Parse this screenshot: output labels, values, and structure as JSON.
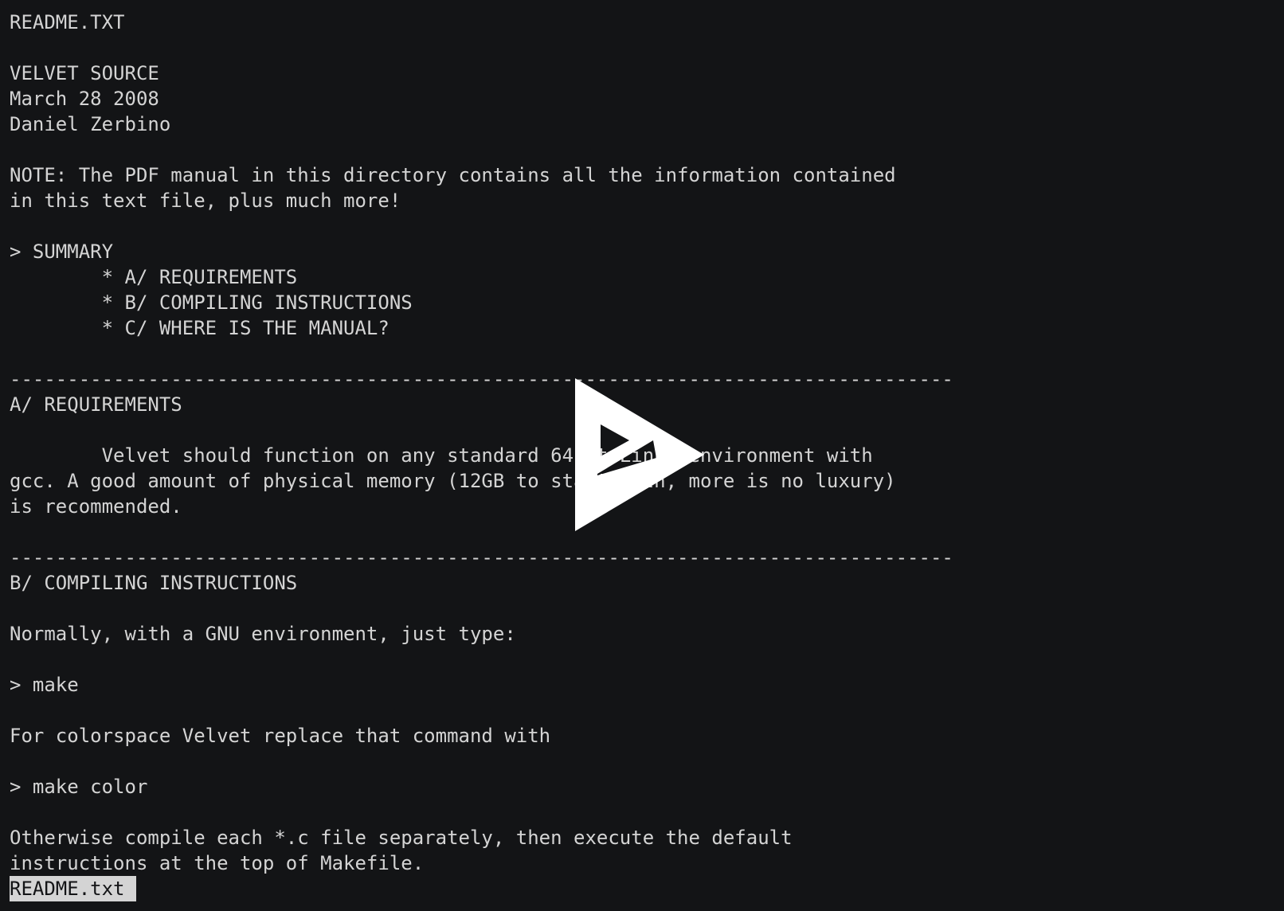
{
  "document": {
    "lines": [
      "README.TXT",
      "",
      "VELVET SOURCE",
      "March 28 2008",
      "Daniel Zerbino",
      "",
      "NOTE: The PDF manual in this directory contains all the information contained",
      "in this text file, plus much more!",
      "",
      "> SUMMARY",
      "        * A/ REQUIREMENTS",
      "        * B/ COMPILING INSTRUCTIONS",
      "        * C/ WHERE IS THE MANUAL?",
      "",
      "----------------------------------------------------------------------------------",
      "A/ REQUIREMENTS",
      "",
      "        Velvet should function on any standard 64bit Linux environment with",
      "gcc. A good amount of physical memory (12GB to start with, more is no luxury)",
      "is recommended.",
      "",
      "----------------------------------------------------------------------------------",
      "B/ COMPILING INSTRUCTIONS",
      "",
      "Normally, with a GNU environment, just type:",
      "",
      "> make",
      "",
      "For colorspace Velvet replace that command with",
      "",
      "> make color",
      "",
      "Otherwise compile each *.c file separately, then execute the default",
      "instructions at the top of Makefile."
    ]
  },
  "status_bar": {
    "filename": "README.txt"
  },
  "overlay": {
    "icon": "play-icon",
    "color": "#ffffff"
  }
}
